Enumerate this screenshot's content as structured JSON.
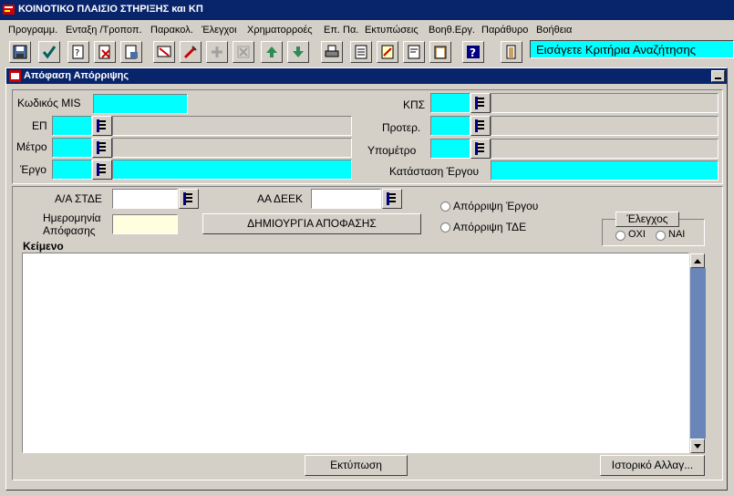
{
  "app": {
    "title": "ΚΟΙΝΟΤΙΚΟ ΠΛΑΙΣΙΟ ΣΤΗΡΙΞΗΣ και ΚΠ"
  },
  "menu": [
    "Προγραμμ.",
    "Ενταξη /Τροποπ.",
    "Παρακολ.",
    "Έλεγχοι",
    "Χρηματορροές",
    "Επ. Πα.",
    "Εκτυπώσεις",
    "Βοηθ.Εργ.",
    "Παράθυρο",
    "Βοήθεια"
  ],
  "toolbar": {
    "hint": "Εισάγετε Κριτήρια Αναζήτησης"
  },
  "window": {
    "title": "Απόφαση Απόρριψης"
  },
  "form": {
    "mis_label": "Κωδικός MIS",
    "ep_label": "ΕΠ",
    "metro_label": "Μέτρο",
    "ergo_label": "Έργο",
    "kps_label": "ΚΠΣ",
    "proter_label": "Προτερ.",
    "ypometro_label": "Υπομέτρο",
    "katastasi_label": "Κατάσταση Έργου",
    "aa_stde_label": "Α/Α ΣΤΔΕ",
    "aa_deek_label": "ΑΑ ΔΕΕΚ",
    "date_label_line1": "Ημερομηνία",
    "date_label_line2": "Απόφασης",
    "create_button": "ΔΗΜΙΟΥΡΓΙΑ ΑΠΟΦΑΣΗΣ",
    "radio_ergou": "Απόρριψη Έργου",
    "radio_tde": "Απόρριψη ΤΔΕ",
    "elegxos_label": "Έλεγχος",
    "oxi": "ΟΧΙ",
    "nai": "ΝΑΙ",
    "keimeno_label": "Κείμενο",
    "print_button": "Εκτύπωση",
    "history_button": "Ιστορικό Αλλαγ..."
  },
  "colors": {
    "required": "#00ffff",
    "titlebar": "#08246b",
    "date_field": "#ffffe0"
  }
}
